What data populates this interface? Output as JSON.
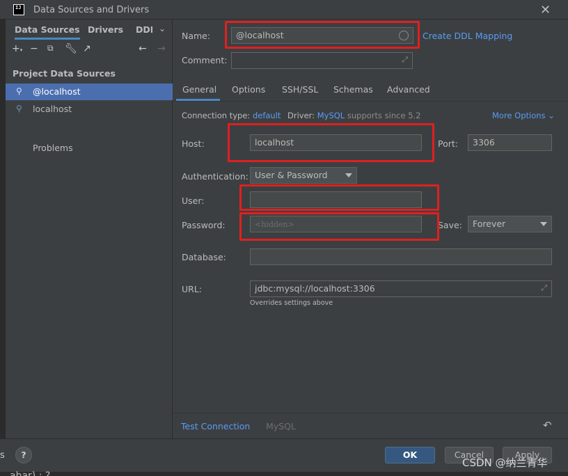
{
  "window": {
    "title": "Data Sources and Drivers",
    "logo_text": "IJ"
  },
  "left": {
    "tabs": [
      "Data Sources",
      "Drivers",
      "DDL"
    ],
    "section_title": "Project Data Sources",
    "items": [
      {
        "label": "@localhost",
        "selected": true
      },
      {
        "label": "localhost",
        "selected": false
      }
    ],
    "problems_label": "Problems"
  },
  "form": {
    "name_label": "Name:",
    "name_value": "@localhost",
    "create_ddl_link": "Create DDL Mapping",
    "comment_label": "Comment:",
    "comment_value": "",
    "tabs": [
      "General",
      "Options",
      "SSH/SSL",
      "Schemas",
      "Advanced"
    ],
    "active_tab": "General",
    "connection_type_label": "Connection type:",
    "connection_type_value": "default",
    "driver_label": "Driver:",
    "driver_value": "MySQL",
    "driver_note": "supports since 5.2",
    "more_options": "More Options",
    "host_label": "Host:",
    "host_value": "localhost",
    "port_label": "Port:",
    "port_value": "3306",
    "auth_label": "Authentication:",
    "auth_value": "User & Password",
    "user_label": "User:",
    "user_value": "",
    "password_label": "Password:",
    "password_placeholder": "<hidden>",
    "save_label": "Save:",
    "save_value": "Forever",
    "database_label": "Database:",
    "database_value": "",
    "url_label": "URL:",
    "url_value": "jdbc:mysql://localhost:3306",
    "url_note": "Overrides settings above",
    "test_connection": "Test Connection",
    "driver_footer": "MySQL"
  },
  "footer": {
    "help": "?",
    "ok": "OK",
    "cancel": "Cancel",
    "apply": "Apply",
    "watermark": "CSDN @纳兰青华"
  },
  "background": {
    "left_fragment": "s",
    "bottom_fragment": "ahar) : ?"
  },
  "colors": {
    "accent": "#4a88c7",
    "link": "#589df6",
    "selection": "#4b6eaf",
    "highlight_box": "#e02020",
    "primary_button": "#365880"
  }
}
